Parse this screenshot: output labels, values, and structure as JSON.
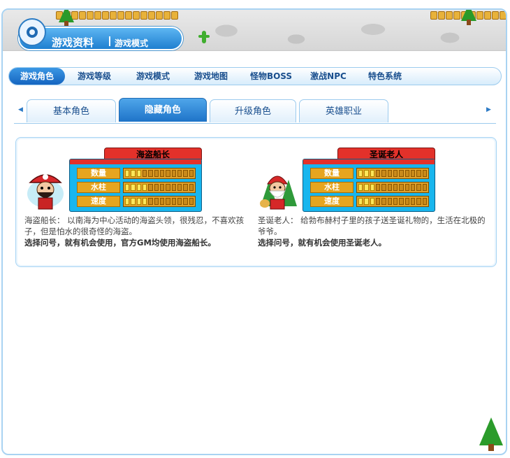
{
  "header": {
    "title": "游戏资料",
    "subtitle": "游戏模式"
  },
  "menu": {
    "items": [
      {
        "label": "游戏角色",
        "active": true
      },
      {
        "label": "游戏等级",
        "active": false
      },
      {
        "label": "游戏模式",
        "active": false
      },
      {
        "label": "游戏地图",
        "active": false
      },
      {
        "label": "怪物BOSS",
        "active": false
      },
      {
        "label": "激战NPC",
        "active": false
      },
      {
        "label": "特色系统",
        "active": false
      }
    ]
  },
  "tabs": {
    "items": [
      {
        "label": "基本角色",
        "active": false
      },
      {
        "label": "隐藏角色",
        "active": true
      },
      {
        "label": "升级角色",
        "active": false
      },
      {
        "label": "英雄职业",
        "active": false
      }
    ],
    "prev_icon": "arrow-left-icon",
    "next_icon": "arrow-right-icon"
  },
  "characters": [
    {
      "name": "海盗船长",
      "stats": [
        {
          "label": "数量",
          "level": 3,
          "max": 12
        },
        {
          "label": "水柱",
          "level": 4,
          "max": 12
        },
        {
          "label": "速度",
          "level": 4,
          "max": 12
        }
      ],
      "description": "海盗船长：  以南海为中心活动的海盗头领，很残忍，不喜欢孩子，但是怕水的很奇怪的海盗。",
      "note": "选择问号，就有机会使用，官方GM均使用海盗船长。"
    },
    {
      "name": "圣诞老人",
      "stats": [
        {
          "label": "数量",
          "level": 3,
          "max": 12
        },
        {
          "label": "水柱",
          "level": 3,
          "max": 12
        },
        {
          "label": "速度",
          "level": 3,
          "max": 12
        }
      ],
      "description": "圣诞老人：  给勃布赫村子里的孩子送圣诞礼物的，生活在北极的爷爷。",
      "note": "选择问号，就有机会使用圣诞老人。"
    }
  ],
  "colors": {
    "accent": "#1e73c8",
    "card_red": "#e3312a",
    "card_blue": "#18b6ee",
    "bar_on": "#ffe65a"
  }
}
